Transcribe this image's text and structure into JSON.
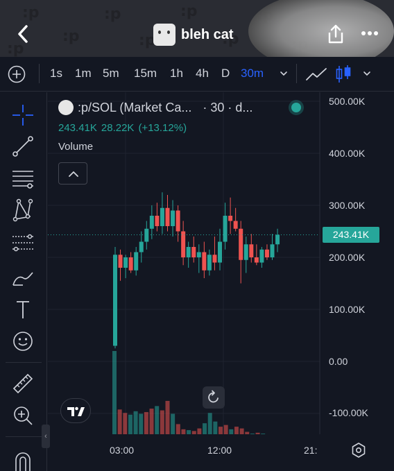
{
  "header": {
    "title": "bleh cat",
    "pattern_glyph": ":p"
  },
  "toolbar": {
    "intervals": [
      "1s",
      "1m",
      "5m",
      "15m",
      "1h",
      "4h",
      "D",
      "30m"
    ],
    "active_interval": "30m"
  },
  "legend": {
    "symbol": ":p/SOL (Market Ca...",
    "interval_text": "· 30 · d...",
    "price": "243.41K",
    "change": "28.22K",
    "change_pct": "(+13.12%)",
    "volume_label": "Volume"
  },
  "price_axis": {
    "labels": [
      "500.00K",
      "400.00K",
      "300.00K",
      "200.00K",
      "100.00K",
      "0.00",
      "-100.00K"
    ],
    "current_price_tag": "243.41K"
  },
  "time_axis": {
    "labels": [
      "03:00",
      "12:00",
      "21:"
    ]
  },
  "colors": {
    "up": "#26a69a",
    "down": "#ef5350",
    "active": "#2962ff",
    "background": "#131722"
  },
  "chart_data": {
    "type": "candlestick",
    "title": "",
    "x_labels": [
      "03:00",
      "12:00",
      "21:"
    ],
    "ylim": [
      -140000,
      520000
    ],
    "y_ticks": [
      500000,
      400000,
      300000,
      200000,
      100000,
      0,
      -100000
    ],
    "current_price": 243410,
    "ohlc": [
      {
        "o": 30000,
        "h": 220000,
        "l": 25000,
        "c": 205000
      },
      {
        "o": 205000,
        "h": 215000,
        "l": 155000,
        "c": 180000
      },
      {
        "o": 180000,
        "h": 205000,
        "l": 160000,
        "c": 200000
      },
      {
        "o": 200000,
        "h": 210000,
        "l": 170000,
        "c": 175000
      },
      {
        "o": 175000,
        "h": 220000,
        "l": 165000,
        "c": 210000
      },
      {
        "o": 210000,
        "h": 250000,
        "l": 190000,
        "c": 230000
      },
      {
        "o": 230000,
        "h": 270000,
        "l": 215000,
        "c": 255000
      },
      {
        "o": 255000,
        "h": 300000,
        "l": 235000,
        "c": 280000
      },
      {
        "o": 280000,
        "h": 305000,
        "l": 250000,
        "c": 260000
      },
      {
        "o": 260000,
        "h": 325000,
        "l": 245000,
        "c": 295000
      },
      {
        "o": 295000,
        "h": 320000,
        "l": 250000,
        "c": 260000
      },
      {
        "o": 260000,
        "h": 310000,
        "l": 240000,
        "c": 290000
      },
      {
        "o": 290000,
        "h": 300000,
        "l": 230000,
        "c": 250000
      },
      {
        "o": 250000,
        "h": 270000,
        "l": 185000,
        "c": 200000
      },
      {
        "o": 200000,
        "h": 230000,
        "l": 180000,
        "c": 220000
      },
      {
        "o": 220000,
        "h": 240000,
        "l": 190000,
        "c": 200000
      },
      {
        "o": 200000,
        "h": 225000,
        "l": 170000,
        "c": 210000
      },
      {
        "o": 210000,
        "h": 230000,
        "l": 160000,
        "c": 175000
      },
      {
        "o": 175000,
        "h": 215000,
        "l": 165000,
        "c": 205000
      },
      {
        "o": 205000,
        "h": 240000,
        "l": 175000,
        "c": 190000
      },
      {
        "o": 190000,
        "h": 255000,
        "l": 175000,
        "c": 230000
      },
      {
        "o": 230000,
        "h": 305000,
        "l": 215000,
        "c": 280000
      },
      {
        "o": 280000,
        "h": 315000,
        "l": 245000,
        "c": 270000
      },
      {
        "o": 270000,
        "h": 295000,
        "l": 250000,
        "c": 255000
      },
      {
        "o": 255000,
        "h": 270000,
        "l": 150000,
        "c": 195000
      },
      {
        "o": 195000,
        "h": 240000,
        "l": 170000,
        "c": 225000
      },
      {
        "o": 225000,
        "h": 245000,
        "l": 190000,
        "c": 200000
      },
      {
        "o": 200000,
        "h": 225000,
        "l": 185000,
        "c": 190000
      },
      {
        "o": 190000,
        "h": 220000,
        "l": 180000,
        "c": 215000
      },
      {
        "o": 215000,
        "h": 225000,
        "l": 195000,
        "c": 200000
      },
      {
        "o": 200000,
        "h": 245000,
        "l": 195000,
        "c": 225000
      },
      {
        "o": 225000,
        "h": 255000,
        "l": 210000,
        "c": 243410
      }
    ],
    "volume": [
      {
        "v": 1.0,
        "up": true
      },
      {
        "v": 0.32,
        "up": false
      },
      {
        "v": 0.28,
        "up": false
      },
      {
        "v": 0.26,
        "up": true
      },
      {
        "v": 0.3,
        "up": true
      },
      {
        "v": 0.27,
        "up": true
      },
      {
        "v": 0.29,
        "up": false
      },
      {
        "v": 0.33,
        "up": false
      },
      {
        "v": 0.36,
        "up": true
      },
      {
        "v": 0.31,
        "up": false
      },
      {
        "v": 0.42,
        "up": false
      },
      {
        "v": 0.27,
        "up": true
      },
      {
        "v": 0.15,
        "up": false
      },
      {
        "v": 0.09,
        "up": false
      },
      {
        "v": 0.08,
        "up": true
      },
      {
        "v": 0.07,
        "up": false
      },
      {
        "v": 0.1,
        "up": false
      },
      {
        "v": 0.16,
        "up": true
      },
      {
        "v": 0.28,
        "up": true
      },
      {
        "v": 0.18,
        "up": true
      },
      {
        "v": 0.12,
        "up": false
      },
      {
        "v": 0.14,
        "up": false
      },
      {
        "v": 0.09,
        "up": true
      },
      {
        "v": 0.12,
        "up": false
      },
      {
        "v": 0.1,
        "up": false
      },
      {
        "v": 0.06,
        "up": false
      },
      {
        "v": 0.04,
        "up": true
      },
      {
        "v": 0.05,
        "up": false
      },
      {
        "v": 0.04,
        "up": true
      }
    ]
  }
}
